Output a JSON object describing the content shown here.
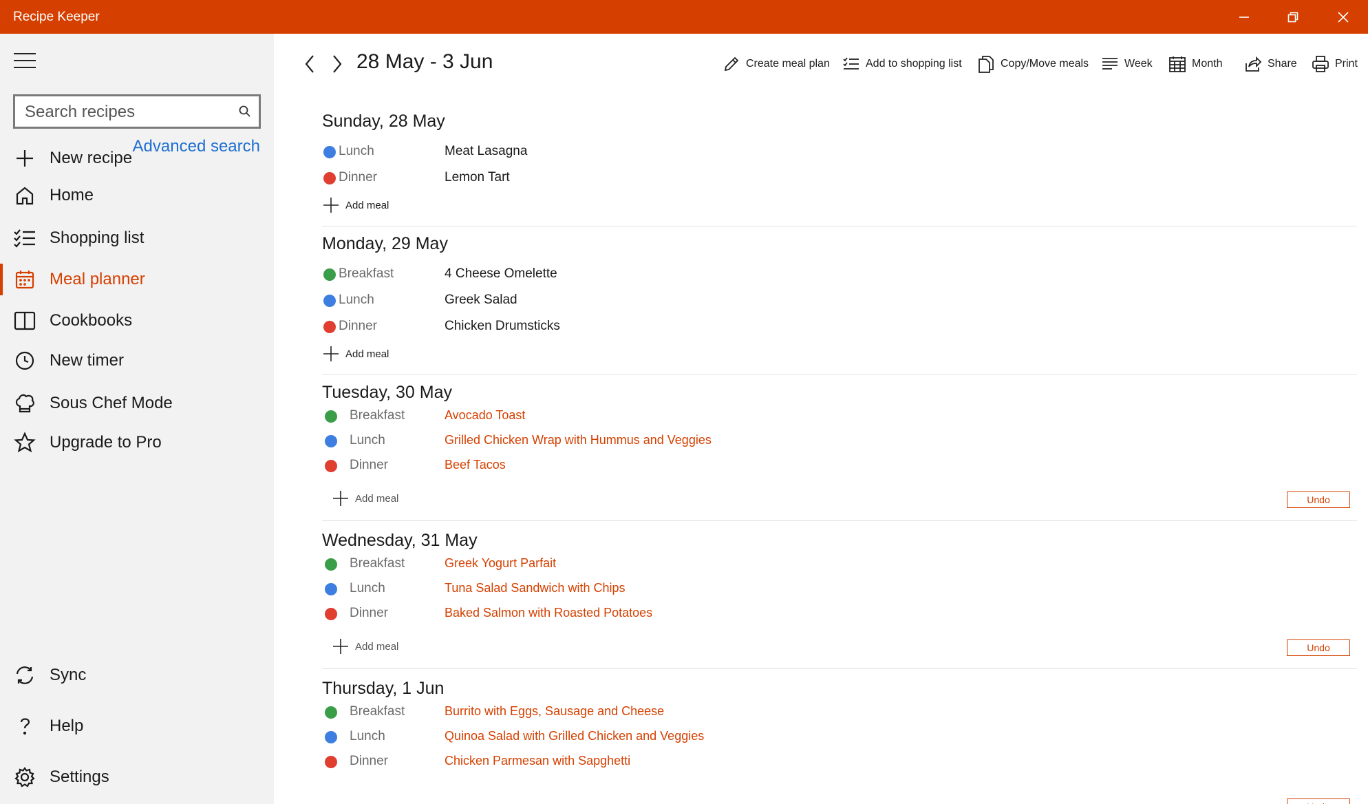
{
  "window": {
    "title": "Recipe Keeper"
  },
  "sidebar": {
    "search": {
      "placeholder": "Search recipes",
      "value": ""
    },
    "advanced_search": "Advanced search",
    "items": [
      {
        "label": "New recipe",
        "icon": "plus-icon"
      },
      {
        "label": "Home",
        "icon": "home-icon"
      },
      {
        "label": "Shopping list",
        "icon": "checklist-icon"
      },
      {
        "label": "Meal planner",
        "icon": "calendar-icon",
        "active": true
      },
      {
        "label": "Cookbooks",
        "icon": "book-icon"
      },
      {
        "label": "New timer",
        "icon": "clock-icon"
      },
      {
        "label": "Sous Chef Mode",
        "icon": "chef-hat-icon"
      },
      {
        "label": "Upgrade to Pro",
        "icon": "star-icon"
      }
    ],
    "bottom_items": [
      {
        "label": "Sync",
        "icon": "sync-icon"
      },
      {
        "label": "Help",
        "icon": "help-icon"
      },
      {
        "label": "Settings",
        "icon": "gear-icon"
      }
    ]
  },
  "header": {
    "range": "28 May - 3 Jun",
    "toolbar": {
      "create_meal_plan": "Create meal plan",
      "add_to_shopping_list": "Add to shopping list",
      "copy_move_meals": "Copy/Move meals",
      "week": "Week",
      "month": "Month",
      "share": "Share",
      "print": "Print"
    }
  },
  "colors": {
    "accent": "#d54000",
    "breakfast": "#3a9e48",
    "lunch": "#3d7ee0",
    "dinner": "#e03e30"
  },
  "add_meal_label": "Add meal",
  "undo_label": "Undo",
  "days": [
    {
      "title": "Sunday, 28 May",
      "meals": [
        {
          "type": "Lunch",
          "name": "Meat Lasagna"
        },
        {
          "type": "Dinner",
          "name": "Lemon Tart"
        }
      ]
    },
    {
      "title": "Monday, 29 May",
      "meals": [
        {
          "type": "Breakfast",
          "name": "4 Cheese Omelette"
        },
        {
          "type": "Lunch",
          "name": "Greek Salad"
        },
        {
          "type": "Dinner",
          "name": "Chicken Drumsticks"
        }
      ]
    },
    {
      "title": "Tuesday, 30 May",
      "meals": [
        {
          "type": "Breakfast",
          "name": "Avocado Toast"
        },
        {
          "type": "Lunch",
          "name": "Grilled Chicken Wrap with Hummus and Veggies"
        },
        {
          "type": "Dinner",
          "name": "Beef Tacos"
        }
      ]
    },
    {
      "title": "Wednesday, 31 May",
      "meals": [
        {
          "type": "Breakfast",
          "name": "Greek Yogurt Parfait"
        },
        {
          "type": "Lunch",
          "name": "Tuna Salad Sandwich with Chips"
        },
        {
          "type": "Dinner",
          "name": "Baked Salmon with Roasted Potatoes"
        }
      ]
    },
    {
      "title": "Thursday, 1 Jun",
      "meals": [
        {
          "type": "Breakfast",
          "name": "Burrito with Eggs, Sausage and Cheese"
        },
        {
          "type": "Lunch",
          "name": "Quinoa Salad with Grilled Chicken and Veggies"
        },
        {
          "type": "Dinner",
          "name": "Chicken Parmesan with Sapghetti"
        }
      ]
    }
  ]
}
